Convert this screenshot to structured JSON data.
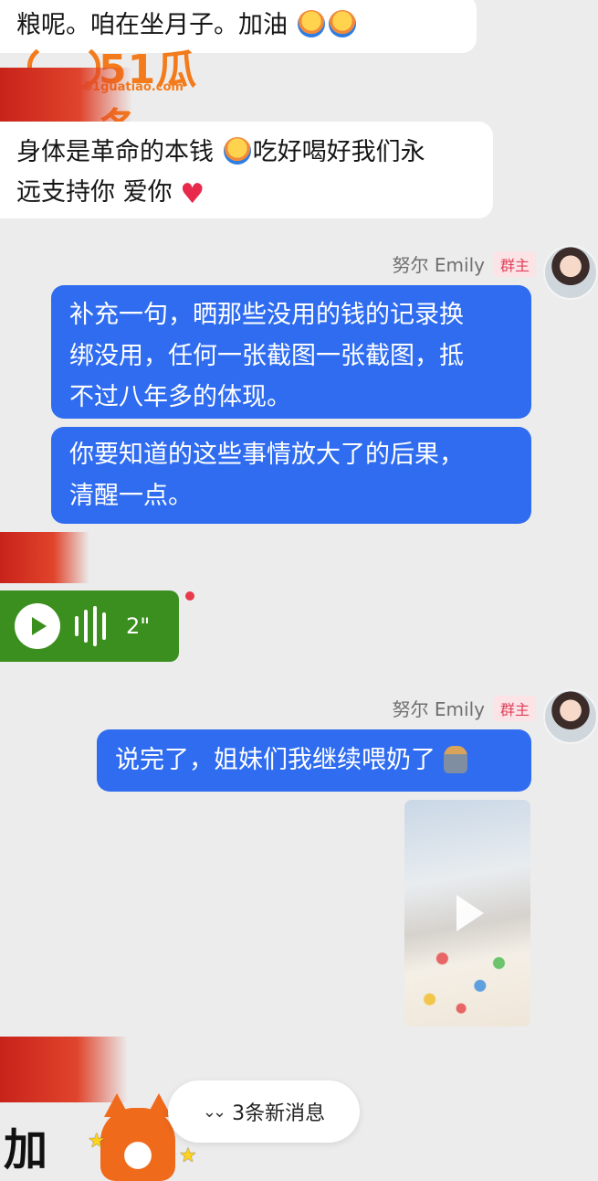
{
  "watermark": {
    "brand": "51瓜条",
    "domain": "51guatiao.com"
  },
  "messages": {
    "partial_top": {
      "text": "粮呢。咱在坐月子。加油"
    },
    "incoming_2": {
      "line1": "身体是革命的本钱",
      "line1b": "吃好喝好我们永",
      "line2": "远支持你 爱你"
    },
    "sender1": {
      "name": "努尔 Emily",
      "badge": "群主"
    },
    "out_1": {
      "line1": "补充一句，晒那些没用的钱的记录换",
      "line2": "绑没用，任何一张截图一张截图，抵",
      "line3": "不过八年多的体现。"
    },
    "out_2": {
      "line1": "你要知道的这些事情放大了的后果，",
      "line2": "清醒一点。"
    },
    "voice": {
      "duration": "2\""
    },
    "sender2": {
      "name": "努尔 Emily",
      "badge": "群主"
    },
    "out_3": {
      "text": "说完了，姐妹们我继续喂奶了"
    }
  },
  "new_messages_button": {
    "label": "3条新消息"
  },
  "sticker": {
    "text": "加"
  },
  "colors": {
    "outgoing_bubble": "#2f6cf0",
    "voice_bubble": "#3b8f1e",
    "badge_text": "#e0405a",
    "watermark": "#f37b1c"
  },
  "icons": [
    "hug-emoji-icon",
    "heart-icon",
    "play-icon",
    "waveform-icon",
    "video-play-icon",
    "chevron-double-down-icon",
    "breastfeeding-emoji-icon"
  ]
}
